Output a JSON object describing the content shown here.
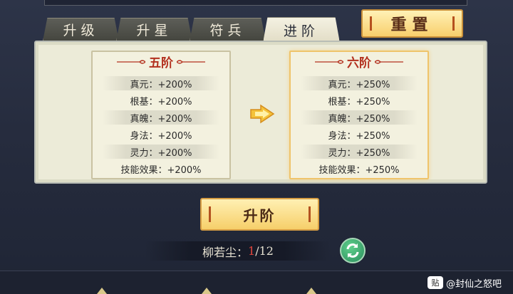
{
  "tabs": [
    {
      "label": "升级",
      "active": false
    },
    {
      "label": "升星",
      "active": false
    },
    {
      "label": "符兵",
      "active": false
    },
    {
      "label": "进阶",
      "active": true
    }
  ],
  "reset_label": "重置",
  "current": {
    "title": "五阶",
    "stats": [
      {
        "text": "真元：+200%"
      },
      {
        "text": "根基：+200%"
      },
      {
        "text": "真魄：+200%"
      },
      {
        "text": "身法：+200%"
      },
      {
        "text": "灵力：+200%"
      },
      {
        "text": "技能效果：+200%"
      }
    ]
  },
  "next": {
    "title": "六阶",
    "stats": [
      {
        "text": "真元：+250%"
      },
      {
        "text": "根基：+250%"
      },
      {
        "text": "真魄：+250%"
      },
      {
        "text": "身法：+250%"
      },
      {
        "text": "灵力：+250%"
      },
      {
        "text": "技能效果：+250%"
      }
    ]
  },
  "advance_button_label": "升阶",
  "material": {
    "name": "柳若尘：",
    "current": "1",
    "required": "/12"
  },
  "watermark": {
    "badge": "贴",
    "text": "@封仙之怒吧"
  },
  "colors": {
    "title_red": "#b3311f",
    "gold_button": "#f6cf6a",
    "count_red": "#e2463c"
  }
}
